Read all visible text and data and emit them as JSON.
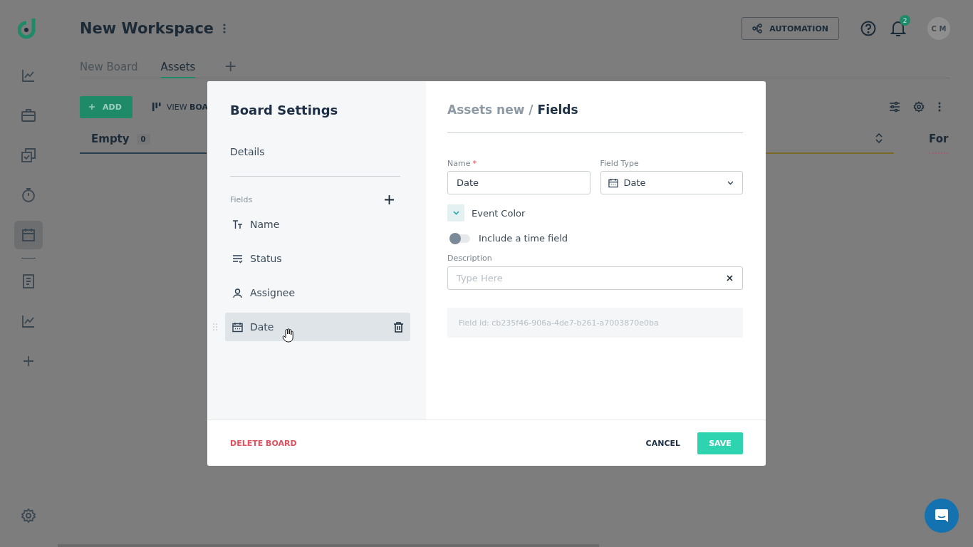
{
  "sidebar": {
    "groups": [
      [
        {
          "kind": "chart",
          "selected": false
        },
        {
          "kind": "briefcase",
          "selected": false
        },
        {
          "kind": "checklist",
          "selected": false
        },
        {
          "kind": "timer",
          "selected": false
        },
        {
          "kind": "calendar",
          "selected": true
        }
      ],
      [
        {
          "kind": "document",
          "selected": false
        },
        {
          "kind": "chart",
          "selected": false
        },
        {
          "kind": "plus",
          "selected": false
        }
      ]
    ],
    "footer": [
      {
        "kind": "settings",
        "selected": false
      }
    ]
  },
  "workspace": {
    "title": "New Workspace"
  },
  "tabs": [
    {
      "label": "New Board",
      "selected": false
    },
    {
      "label": "Assets",
      "selected": true
    }
  ],
  "add_tab": "+",
  "header": {
    "automation": "AUTOMATION",
    "notification_count": "2",
    "avatar": "C M"
  },
  "toolbar": {
    "add": "ADD",
    "view": "VIEW **BOA**"
  },
  "columns": [
    {
      "title": "Empty",
      "count": "0"
    },
    {
      "title": "For"
    }
  ],
  "modal": {
    "title": "Board Settings",
    "nav": "Details",
    "fields_label": "Fields",
    "fields": [
      {
        "label": "Name",
        "kind": "text",
        "selected": false
      },
      {
        "label": "Status",
        "kind": "status",
        "selected": false
      },
      {
        "label": "Assignee",
        "kind": "person",
        "selected": false
      },
      {
        "label": "Date",
        "kind": "date",
        "selected": true
      }
    ],
    "delete": "DELETE BOARD",
    "breadcrumb": "Assets new /",
    "section": "Fields",
    "name_label": "Name",
    "required": "*",
    "name_value": "Date",
    "type_label": "Field Type",
    "type_value": "Date",
    "event_color": {
      "label": "Event Color",
      "expanded": false
    },
    "time_toggle": {
      "label": "Include a time field",
      "on": false
    },
    "description_label": "Description",
    "description_placeholder": "Type Here",
    "field_id": "Field Id: cb235f46-906a-4de7-b261-a7003870e0ba",
    "cancel": "CANCEL",
    "save": "SAVE"
  }
}
